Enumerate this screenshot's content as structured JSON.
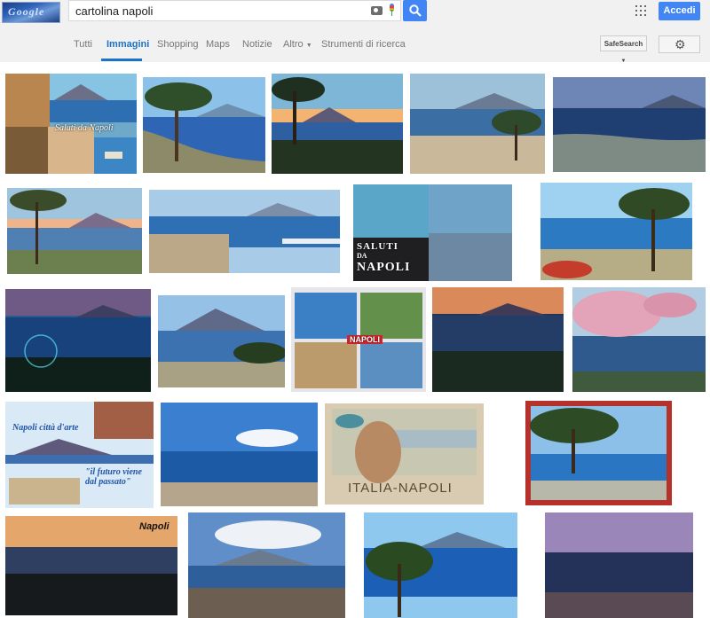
{
  "header": {
    "logo_text": "Google",
    "search": {
      "query": "cartolina napoli"
    },
    "signin_label": "Accedi"
  },
  "nav": {
    "tabs": [
      "Tutti",
      "Immagini",
      "Shopping",
      "Maps",
      "Notizie",
      "Altro",
      "Strumenti di ricerca"
    ],
    "active_tab": "Immagini",
    "safesearch_label": "SafeSearch"
  },
  "thumbnails": {
    "captions": {
      "t1": "Saluti da Napoli",
      "t8a": "SALUTI",
      "t8b": "DA",
      "t8c": "NAPOLI",
      "t13": "NAPOLI",
      "t15a": "Napoli città d'arte",
      "t15b": "\"il futuro viene dal passato\"",
      "t17": "ITALIA-NAPOLI",
      "t19": "Napoli"
    }
  }
}
